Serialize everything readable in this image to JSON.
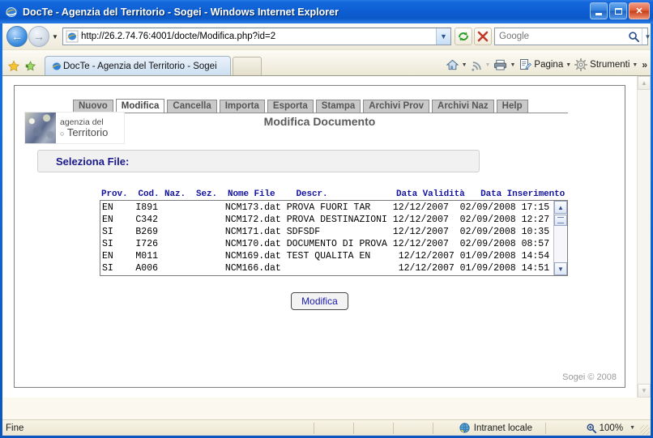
{
  "window": {
    "title": "DocTe - Agenzia del Territorio - Sogei - Windows Internet Explorer",
    "minimize_label": "Minimize",
    "maximize_label": "Maximize",
    "close_label": "Close"
  },
  "browser": {
    "back_label": "Back",
    "forward_label": "Forward",
    "history_label": "Recent Pages",
    "address": "http://26.2.74.76:4001/docte/Modifica.php?id=2",
    "address_dropdown_label": "Address history",
    "refresh_label": "Refresh",
    "stop_label": "Stop",
    "search_value": "",
    "search_placeholder": "Google",
    "search_go_label": "Search",
    "search_dropdown_label": "Search providers",
    "tab_title": "DocTe - Agenzia del Territorio - Sogei",
    "new_tab_label": "New Tab",
    "favorites_center_label": "Favorites Center",
    "add_favorite_label": "Add to Favorites",
    "toolbar": [
      {
        "name": "home-icon",
        "label": ""
      },
      {
        "name": "feeds-icon",
        "label": ""
      },
      {
        "name": "print-icon",
        "label": ""
      },
      {
        "name": "page-icon",
        "label": "Pagina"
      },
      {
        "name": "tools-icon",
        "label": "Strumenti"
      }
    ],
    "overflow_label": "»"
  },
  "app": {
    "tabs": [
      {
        "label": "Nuovo",
        "active": false
      },
      {
        "label": "Modifica",
        "active": true
      },
      {
        "label": "Cancella",
        "active": false
      },
      {
        "label": "Importa",
        "active": false
      },
      {
        "label": "Esporta",
        "active": false
      },
      {
        "label": "Stampa",
        "active": false
      },
      {
        "label": "Archivi Prov",
        "active": false
      },
      {
        "label": "Archivi Naz",
        "active": false
      },
      {
        "label": "Help",
        "active": false
      }
    ],
    "logo": {
      "line1": "agenzia del",
      "line2_symbol": "○",
      "line2": "Territorio"
    },
    "page_title": "Modifica Documento",
    "select_file_label": "Seleziona File:",
    "submit_label": "Modifica",
    "copyright": "Sogei © 2008"
  },
  "table": {
    "headers": [
      "Prov.",
      "Cod. Naz.",
      "Sez.",
      "Nome File",
      "Descr.",
      "Data Validità",
      "Data Inserimento"
    ],
    "header_line": "Prov.  Cod. Naz.  Sez.  Nome File    Descr.             Data Validità   Data Inserimento",
    "rows": [
      {
        "prov": "EN",
        "cod_naz": "I891",
        "sez": "",
        "nome_file": "NCM173.dat",
        "descr": "PROVA FUORI TAR",
        "data_validita": "12/12/2007",
        "data_inserimento": "02/09/2008 17:15",
        "line": "EN    I891            NCM173.dat PROVA FUORI TAR    12/12/2007  02/09/2008 17:15"
      },
      {
        "prov": "EN",
        "cod_naz": "C342",
        "sez": "",
        "nome_file": "NCM172.dat",
        "descr": "PROVA DESTINAZIONI",
        "data_validita": "12/12/2007",
        "data_inserimento": "02/09/2008 12:27",
        "line": "EN    C342            NCM172.dat PROVA DESTINAZIONI 12/12/2007  02/09/2008 12:27"
      },
      {
        "prov": "SI",
        "cod_naz": "B269",
        "sez": "",
        "nome_file": "NCM171.dat",
        "descr": "SDFSDF",
        "data_validita": "12/12/2007",
        "data_inserimento": "02/09/2008 10:35",
        "line": "SI    B269            NCM171.dat SDFSDF             12/12/2007  02/09/2008 10:35"
      },
      {
        "prov": "SI",
        "cod_naz": "I726",
        "sez": "",
        "nome_file": "NCM170.dat",
        "descr": "DOCUMENTO DI PROVA",
        "data_validita": "12/12/2007",
        "data_inserimento": "02/09/2008 08:57",
        "line": "SI    I726            NCM170.dat DOCUMENTO DI PROVA 12/12/2007  02/09/2008 08:57"
      },
      {
        "prov": "EN",
        "cod_naz": "M011",
        "sez": "",
        "nome_file": "NCM169.dat",
        "descr": "TEST QUALITA EN",
        "data_validita": "12/12/2007",
        "data_inserimento": "01/09/2008 14:54",
        "line": "EN    M011            NCM169.dat TEST QUALITA EN     12/12/2007 01/09/2008 14:54"
      },
      {
        "prov": "SI",
        "cod_naz": "A006",
        "sez": "",
        "nome_file": "NCM166.dat",
        "descr": "",
        "data_validita": "12/12/2007",
        "data_inserimento": "01/09/2008 14:51",
        "line": "SI    A006            NCM166.dat                     12/12/2007 01/09/2008 14:51"
      }
    ],
    "scroll_up_label": "▲",
    "scroll_down_label": "▼"
  },
  "statusbar": {
    "status": "Fine",
    "zone": "Intranet locale",
    "zoom": "100%",
    "zoom_dropdown_label": "Change zoom level"
  },
  "colors": {
    "title_blue": "#0b5fd4",
    "tab_active_bg": "#ffffff",
    "tab_inactive_bg": "#c9c9c9",
    "heading_navy": "#1414a0",
    "page_title_gray": "#5a5a5a",
    "button_text": "#1a1aa8",
    "status_bg": "#ece7d2"
  }
}
